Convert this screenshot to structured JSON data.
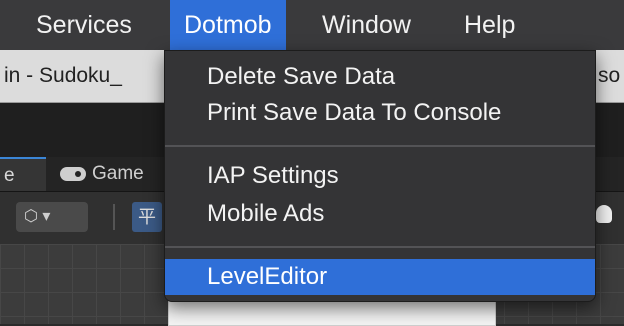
{
  "menubar": {
    "items": [
      {
        "label": "Services"
      },
      {
        "label": "Dotmob"
      },
      {
        "label": "Window"
      },
      {
        "label": "Help"
      }
    ],
    "active_index": 1
  },
  "window": {
    "title_left": "in - Sudoku_",
    "title_right": "so",
    "tabs": {
      "scene_fragment": "e",
      "game_label": "Game",
      "game_icon": "gamepad-icon"
    },
    "toolbar": {
      "cube_icon": "cube-icon",
      "grid_glyph": "平"
    }
  },
  "dropdown": {
    "groups": [
      [
        "Delete Save Data",
        "Print Save Data To Console"
      ],
      [
        "IAP Settings",
        "Mobile Ads"
      ],
      [
        "LevelEditor"
      ]
    ],
    "highlighted": "LevelEditor"
  },
  "colors": {
    "accent": "#2f6fd8",
    "menubar_bg": "#3a3a3c",
    "menu_bg": "#343436"
  }
}
